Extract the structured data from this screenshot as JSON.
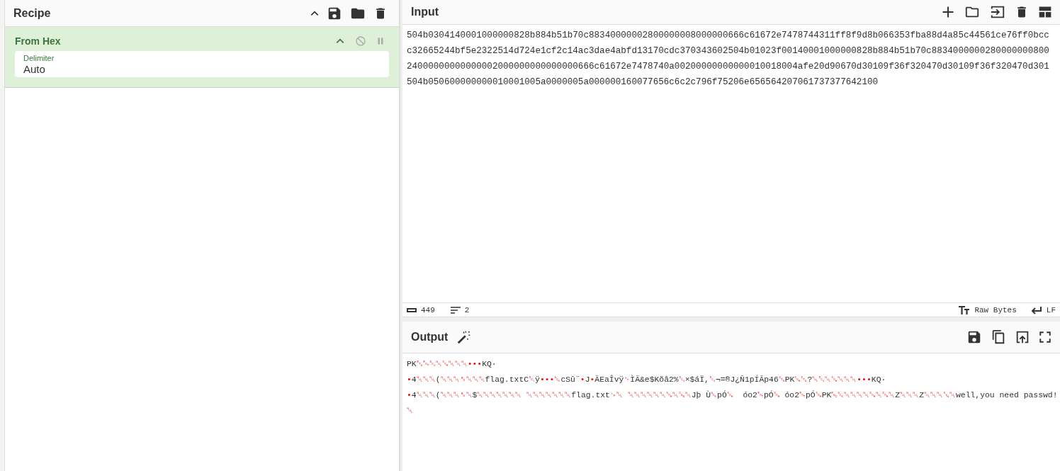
{
  "recipe": {
    "title": "Recipe",
    "operations": [
      {
        "name": "From Hex",
        "args": [
          {
            "label": "Delimiter",
            "value": "Auto"
          }
        ]
      }
    ]
  },
  "input": {
    "title": "Input",
    "lines": [
      "504b0304140001000000828b884b51b70c88340000002800000008000000666c61672e7478744311ff8f9d8b066353fba88d4a85c44561ce76ff0bcc",
      "c32665244bf5e2322514d724e1cf2c14ac3dae4abfd13170cdc370343602504b01023f00140001000000828b884b51b70c8834000000280000000800",
      "24000000000000002000000000000000666c61672e7478740a00200000000000010018004afe20d90670d30109f36f320470d30109f36f320470d301",
      "504b050600000000010001005a0000005a000000160077656c6c2c796f75206e656564207061737377642100"
    ],
    "status": {
      "length": "449",
      "lines": "2",
      "encoding": "Raw Bytes",
      "eol": "LF"
    }
  },
  "output": {
    "title": "Output",
    "lines": [
      "PK␃␄␔␀␁␀␀␀•••KQ·",
      "•4␀␀␀(␀␀␀␈␀␀␀flag.txtC␑ÿ•••␆cSû¨•J•ÄEaÎvÿ␋ÌÃ&e$Kõâ2%␔×$áÏ,␔¬=®J¿Ñ1pÍÃp46␂PK␁␂?␀␔␀␁␀␀␀•••KQ·",
      "•4␀␀␀(␀␀␀␈␀$␀␀␀␀␀␀␀ ␀␀␀␀␀␀␀flag.txt␊␀ ␀␀␀␀␀␀␁␀␘␀Jþ Ù␆pÓ␁  óo2␄pÓ␁ óo2␄pÓ␁PK␅␆␀␀␀␀␁␀␁␀Z␀␀␀Z␀␀␀␖␀well,you need passwd!",
      "␀"
    ]
  }
}
